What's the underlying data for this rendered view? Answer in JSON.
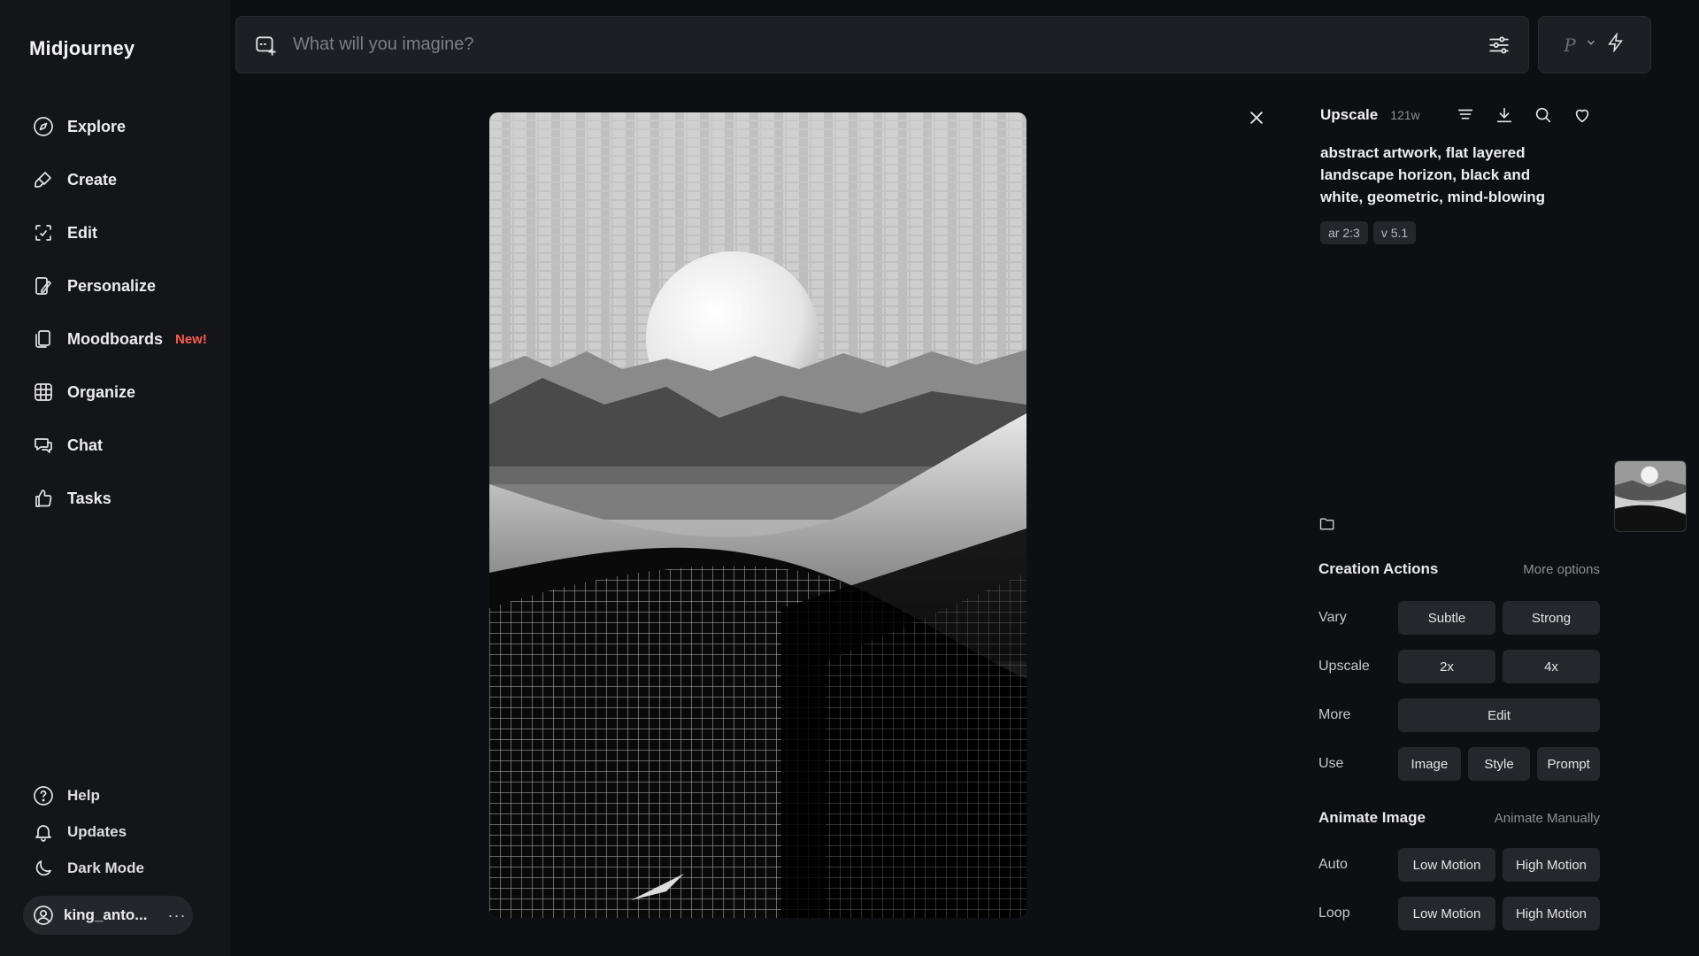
{
  "app": {
    "title": "Midjourney"
  },
  "sidebar": {
    "items": [
      {
        "label": "Explore",
        "icon": "compass-icon"
      },
      {
        "label": "Create",
        "icon": "brush-icon"
      },
      {
        "label": "Edit",
        "icon": "edit-icon"
      },
      {
        "label": "Personalize",
        "icon": "personalize-icon"
      },
      {
        "label": "Moodboards",
        "icon": "moodboard-icon",
        "badge": "New!"
      },
      {
        "label": "Organize",
        "icon": "grid-icon"
      },
      {
        "label": "Chat",
        "icon": "chat-icon"
      },
      {
        "label": "Tasks",
        "icon": "thumbs-up-icon"
      }
    ],
    "bottom": [
      {
        "label": "Help",
        "icon": "help-icon"
      },
      {
        "label": "Updates",
        "icon": "bell-icon"
      },
      {
        "label": "Dark Mode",
        "icon": "moon-icon"
      }
    ],
    "user": {
      "name": "king_anto...",
      "more": "···"
    },
    "badge_color": "#ff5a4f"
  },
  "search": {
    "placeholder": "What will you imagine?"
  },
  "mode": {
    "letter": "P"
  },
  "detail": {
    "title": "Upscale",
    "age": "121w",
    "prompt": "abstract artwork, flat layered landscape horizon, black and white, geometric, mind-blowing",
    "tags": [
      "ar 2:3",
      "v 5.1"
    ]
  },
  "creation": {
    "title": "Creation Actions",
    "more": "More options",
    "rows": [
      {
        "label": "Vary",
        "buttons": [
          "Subtle",
          "Strong"
        ]
      },
      {
        "label": "Upscale",
        "buttons": [
          "2x",
          "4x"
        ]
      },
      {
        "label": "More",
        "buttons": [
          "Edit"
        ]
      },
      {
        "label": "Use",
        "buttons": [
          "Image",
          "Style",
          "Prompt"
        ]
      }
    ]
  },
  "animate": {
    "title": "Animate Image",
    "more": "Animate Manually",
    "rows": [
      {
        "label": "Auto",
        "buttons": [
          "Low Motion",
          "High Motion"
        ]
      },
      {
        "label": "Loop",
        "buttons": [
          "Low Motion",
          "High Motion"
        ]
      }
    ]
  }
}
